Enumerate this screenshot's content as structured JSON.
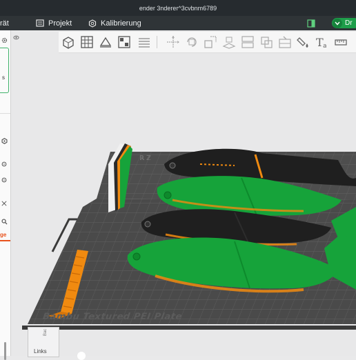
{
  "window": {
    "title": "ender 3nderer^3cvbnm6789"
  },
  "menubar": {
    "device_label": "rät",
    "project_label": "Projekt",
    "calibration_label": "Kalibrierung",
    "slice_label": "Dr"
  },
  "toolbar": {
    "tools": [
      "add-object",
      "arrange-grid",
      "orient",
      "auto-arrange",
      "layers",
      "move",
      "rotate",
      "scale",
      "lay-on-face",
      "cut",
      "support-paint",
      "seam-paint",
      "color-paint",
      "text",
      "measure"
    ]
  },
  "left_panel": {
    "visible_fragment": "s",
    "tab_fragment": "ge",
    "tab_color": "#e8521c"
  },
  "plate": {
    "label": "Bambu Textured PEI Plate"
  },
  "navcube": {
    "face_label": "Links",
    "side_label": "Bac"
  },
  "colors": {
    "accent": "#1e9e4a",
    "filament_green": "#16a33a",
    "filament_black": "#222222",
    "filament_orange": "#f08a10",
    "plate": "#4a4a4a"
  }
}
